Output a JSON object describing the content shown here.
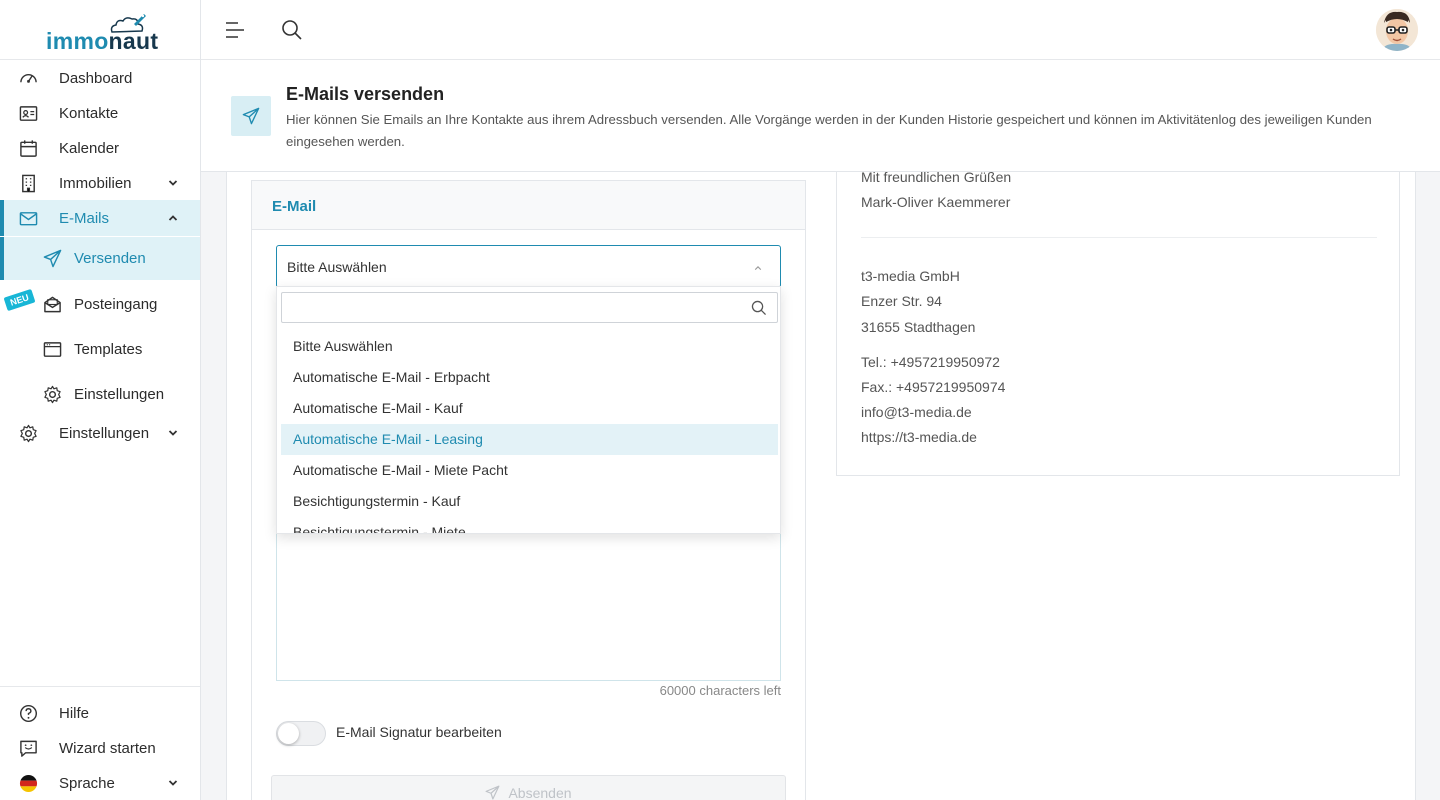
{
  "app": {
    "logo_part1": "immo",
    "logo_part2": "naut"
  },
  "sidebar": {
    "items": [
      {
        "label": "Dashboard"
      },
      {
        "label": "Kontakte"
      },
      {
        "label": "Kalender"
      },
      {
        "label": "Immobilien"
      },
      {
        "label": "E-Mails"
      },
      {
        "label": "Versenden"
      },
      {
        "label": "Posteingang"
      },
      {
        "label": "Templates"
      },
      {
        "label": "Einstellungen"
      },
      {
        "label": "Einstellungen"
      }
    ],
    "badge": "NEU",
    "bottom": [
      {
        "label": "Hilfe"
      },
      {
        "label": "Wizard starten"
      },
      {
        "label": "Sprache"
      }
    ]
  },
  "page": {
    "title": "E-Mails versenden",
    "description": "Hier können Sie Emails an Ihre Kontakte aus ihrem Adressbuch versenden. Alle Vorgänge werden in der Kunden Historie gespeichert und können im Aktivitätenlog des jeweiligen Kunden eingesehen werden."
  },
  "email_panel": {
    "title": "E-Mail",
    "select_value": "Bitte Auswählen",
    "search_placeholder": "",
    "options": [
      "Bitte Auswählen",
      "Automatische E-Mail - Erbpacht",
      "Automatische E-Mail - Kauf",
      "Automatische E-Mail - Leasing",
      "Automatische E-Mail - Miete Pacht",
      "Besichtigungstermin - Kauf",
      "Besichtigungstermin - Miete"
    ],
    "highlighted_option": "Automatische E-Mail - Leasing",
    "chars_left": "60000 characters left",
    "signature_toggle_label": "E-Mail Signatur bearbeiten",
    "signature_toggle_on": false,
    "send_label": "Absenden"
  },
  "signature": {
    "greeting": "Mit freundlichen Grüßen",
    "name": "Mark-Oliver Kaemmerer",
    "company": "t3-media GmbH",
    "street": "Enzer Str. 94",
    "city": "31655 Stadthagen",
    "tel": "Tel.: +4957219950972",
    "fax": "Fax.: +4957219950974",
    "email": "info@t3-media.de",
    "web": "https://t3-media.de"
  },
  "colors": {
    "accent": "#1f8bb0",
    "accent_light": "#dff2f7",
    "badge": "#18b6d6"
  }
}
